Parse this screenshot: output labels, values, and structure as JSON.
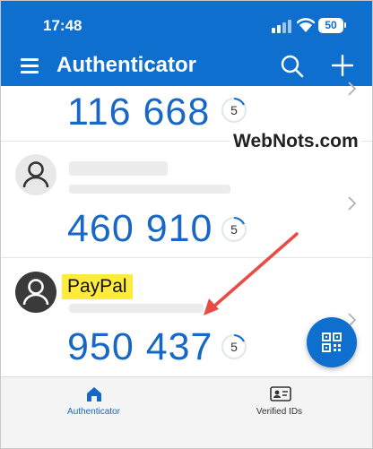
{
  "status_bar": {
    "time": "17:48",
    "battery": "50"
  },
  "header": {
    "title": "Authenticator",
    "icons": [
      "menu-icon",
      "search-icon",
      "add-icon"
    ]
  },
  "accounts": [
    {
      "code": "116 668",
      "timer": "5"
    },
    {
      "code": "460 910",
      "timer": "5"
    },
    {
      "name": "PayPal",
      "code": "950 437",
      "timer": "5"
    }
  ],
  "watermark": "WebNots.com",
  "fab": {
    "icon": "qr-scan-icon"
  },
  "bottom_nav": {
    "items": [
      {
        "label": "Authenticator",
        "icon": "home-icon",
        "active": true
      },
      {
        "label": "Verified IDs",
        "icon": "id-card-icon",
        "active": false
      }
    ]
  },
  "colors": {
    "brand": "#0f6fcf",
    "code": "#1768c6",
    "highlight": "#ffeb3b",
    "arrow": "#e84c45"
  }
}
